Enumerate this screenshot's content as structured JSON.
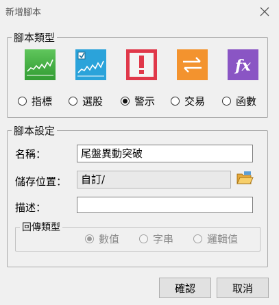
{
  "window": {
    "title": "新增腳本"
  },
  "script_type": {
    "legend": "腳本類型",
    "options": [
      {
        "label": "指標",
        "icon": "indicator-chart-icon",
        "color": "#3fae3f",
        "selected": false
      },
      {
        "label": "選股",
        "icon": "stock-select-icon",
        "color": "#2ba3da",
        "selected": false
      },
      {
        "label": "警示",
        "icon": "alert-exclamation-icon",
        "color": "#e0384a",
        "selected": true
      },
      {
        "label": "交易",
        "icon": "trade-arrows-icon",
        "color": "#f3932e",
        "selected": false
      },
      {
        "label": "函數",
        "icon": "function-fx-icon",
        "color": "#8a55c4",
        "selected": false
      }
    ]
  },
  "script_settings": {
    "legend": "腳本設定",
    "name_label": "名稱：",
    "name_value": "尾盤異動突破",
    "path_label": "儲存位置：",
    "path_value": "自訂/",
    "desc_label": "描述：",
    "desc_value": "",
    "return_type": {
      "legend": "回傳類型",
      "options": [
        {
          "label": "數值",
          "selected": true
        },
        {
          "label": "字串",
          "selected": false
        },
        {
          "label": "邏輯值",
          "selected": false
        }
      ]
    }
  },
  "buttons": {
    "ok": "確認",
    "cancel": "取消"
  }
}
